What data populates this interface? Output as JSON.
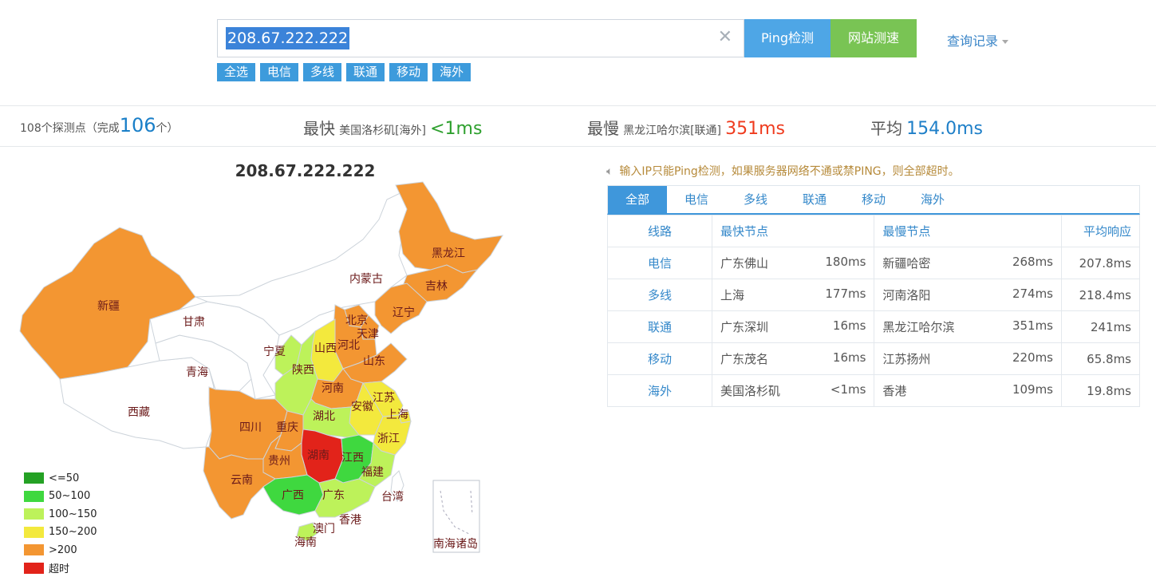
{
  "search": {
    "value": "208.67.222.222",
    "clear_icon": "close-icon"
  },
  "buttons": {
    "ping": "Ping检测",
    "speed": "网站测速",
    "history": "查询记录"
  },
  "filters": [
    "全选",
    "电信",
    "多线",
    "联通",
    "移动",
    "海外"
  ],
  "summary": {
    "probes_prefix": "108个探测点（完成",
    "probes_done": "106",
    "probes_suffix": "个）",
    "fastest_label": "最快",
    "fastest_location": "美国洛杉矶[海外]",
    "fastest_value": "<1ms",
    "slowest_label": "最慢",
    "slowest_location": "黑龙江哈尔滨[联通]",
    "slowest_value": "351ms",
    "avg_label": "平均",
    "avg_value": "154.0ms"
  },
  "map": {
    "title": "208.67.222.222",
    "colors": {
      "c50": "#24a124",
      "c100": "#3fd83f",
      "c150": "#bdf25a",
      "c200": "#f3e93d",
      "c200p": "#f39632",
      "timeout": "#e2231a",
      "none": "#ffffff"
    },
    "provinces": {
      "xinjiang": "新疆",
      "xizang": "西藏",
      "qinghai": "青海",
      "gansu": "甘肃",
      "neimenggu": "内蒙古",
      "heilongjiang": "黑龙江",
      "jilin": "吉林",
      "liaoning": "辽宁",
      "beijing": "北京",
      "tianjin": "天津",
      "hebei": "河北",
      "shanxi": "山西",
      "shandong": "山东",
      "ningxia": "宁夏",
      "shaanxi": "陕西",
      "henan": "河南",
      "jiangsu": "江苏",
      "anhui": "安徽",
      "shanghai": "上海",
      "hubei": "湖北",
      "sichuan": "四川",
      "chongqing": "重庆",
      "zhejiang": "浙江",
      "hunan": "湖南",
      "jiangxi": "江西",
      "guizhou": "贵州",
      "fujian": "福建",
      "yunnan": "云南",
      "guangxi": "广西",
      "guangdong": "广东",
      "taiwan": "台湾",
      "xianggang": "香港",
      "aomen": "澳门",
      "hainan": "海南",
      "nanhai": "南海诸岛"
    }
  },
  "legend": [
    {
      "label": "<=50",
      "color": "#24a124"
    },
    {
      "label": "50~100",
      "color": "#3fd83f"
    },
    {
      "label": "100~150",
      "color": "#bdf25a"
    },
    {
      "label": "150~200",
      "color": "#f3e93d"
    },
    {
      "label": ">200",
      "color": "#f39632"
    },
    {
      "label": "超时",
      "color": "#e2231a"
    }
  ],
  "notice": "输入IP只能Ping检测，如果服务器网络不通或禁PING，则全部超时。",
  "tabs": [
    "全部",
    "电信",
    "多线",
    "联通",
    "移动",
    "海外"
  ],
  "table": {
    "headers": {
      "line": "线路",
      "fastest": "最快节点",
      "slowest": "最慢节点",
      "avg": "平均响应"
    },
    "rows": [
      {
        "line": "电信",
        "fast_node": "广东佛山",
        "fast_ms": "180ms",
        "slow_node": "新疆哈密",
        "slow_ms": "268ms",
        "avg": "207.8ms"
      },
      {
        "line": "多线",
        "fast_node": "上海",
        "fast_ms": "177ms",
        "slow_node": "河南洛阳",
        "slow_ms": "274ms",
        "avg": "218.4ms"
      },
      {
        "line": "联通",
        "fast_node": "广东深圳",
        "fast_ms": "16ms",
        "slow_node": "黑龙江哈尔滨",
        "slow_ms": "351ms",
        "avg": "241ms"
      },
      {
        "line": "移动",
        "fast_node": "广东茂名",
        "fast_ms": "16ms",
        "slow_node": "江苏扬州",
        "slow_ms": "220ms",
        "avg": "65.8ms"
      },
      {
        "line": "海外",
        "fast_node": "美国洛杉矶",
        "fast_ms": "<1ms",
        "slow_node": "香港",
        "slow_ms": "109ms",
        "avg": "19.8ms"
      }
    ]
  }
}
